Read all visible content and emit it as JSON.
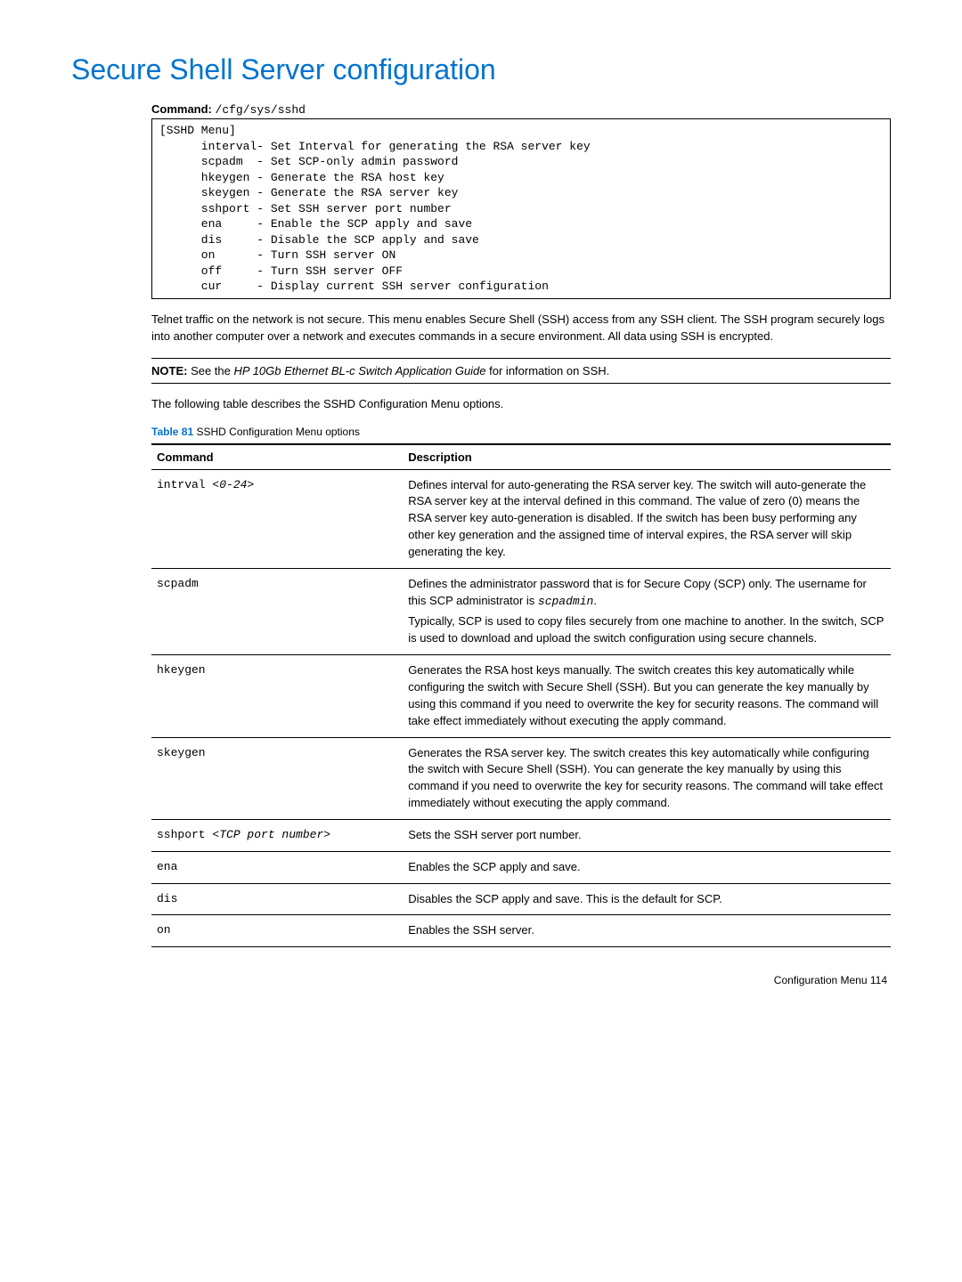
{
  "title": "Secure Shell Server configuration",
  "command": {
    "label": "Command:",
    "value": "/cfg/sys/sshd"
  },
  "codeBox": "[SSHD Menu]\n      interval- Set Interval for generating the RSA server key\n      scpadm  - Set SCP-only admin password\n      hkeygen - Generate the RSA host key\n      skeygen - Generate the RSA server key\n      sshport - Set SSH server port number\n      ena     - Enable the SCP apply and save\n      dis     - Disable the SCP apply and save\n      on      - Turn SSH server ON\n      off     - Turn SSH server OFF\n      cur     - Display current SSH server configuration",
  "para1": "Telnet traffic on the network is not secure. This menu enables Secure Shell (SSH) access from any SSH client. The SSH program securely logs into another computer over a network and executes commands in a secure environment. All data using SSH is encrypted.",
  "note": {
    "label": "NOTE:",
    "pre": " See the ",
    "em": "HP 10Gb Ethernet BL-c Switch Application Guide",
    "post": " for information on SSH."
  },
  "para2": "The following table describes the SSHD Configuration Menu options.",
  "tableCaption": {
    "num": "Table 81",
    "text": "  SSHD Configuration Menu options"
  },
  "tableHead": {
    "c1": "Command",
    "c2": "Description"
  },
  "rows": [
    {
      "cmdPre": "intrval ",
      "cmdArg": "<0-24>",
      "desc": "Defines interval for auto-generating the RSA server key. The switch will auto-generate the RSA server key at the interval defined in this command. The value of zero (0) means the RSA server key auto-generation is disabled. If the switch has been busy performing any other key generation and the assigned time of interval expires, the RSA server will skip generating the key."
    },
    {
      "cmdPre": "scpadm",
      "cmdArg": "",
      "descPre": "Defines the administrator password that is for Secure Copy (SCP) only. The username for this SCP administrator is ",
      "descMono": "scpadmin",
      "descMid": ".",
      "desc2": "Typically, SCP is used to copy files securely from one machine to another. In the switch, SCP is used to download and upload the switch configuration using secure channels."
    },
    {
      "cmdPre": "hkeygen",
      "cmdArg": "",
      "desc": "Generates the RSA host keys manually. The switch creates this key automatically while configuring the switch with Secure Shell (SSH). But you can generate the key manually by using this command if you need to overwrite the key for security reasons. The command will take effect immediately without executing the apply command."
    },
    {
      "cmdPre": "skeygen",
      "cmdArg": "",
      "desc": "Generates the RSA server key. The switch creates this key automatically while configuring the switch with Secure Shell (SSH). You can generate the key manually by using this command if you need to overwrite the key for security reasons. The command will take effect immediately without executing the apply command."
    },
    {
      "cmdPre": "sshport ",
      "cmdArg": "<TCP port number>",
      "desc": "Sets the SSH server port number."
    },
    {
      "cmdPre": "ena",
      "cmdArg": "",
      "desc": "Enables the SCP apply and save."
    },
    {
      "cmdPre": "dis",
      "cmdArg": "",
      "desc": "Disables the SCP apply and save. This is the default for SCP."
    },
    {
      "cmdPre": "on",
      "cmdArg": "",
      "desc": "Enables the SSH server."
    }
  ],
  "footer": {
    "text": "Configuration Menu   114"
  }
}
